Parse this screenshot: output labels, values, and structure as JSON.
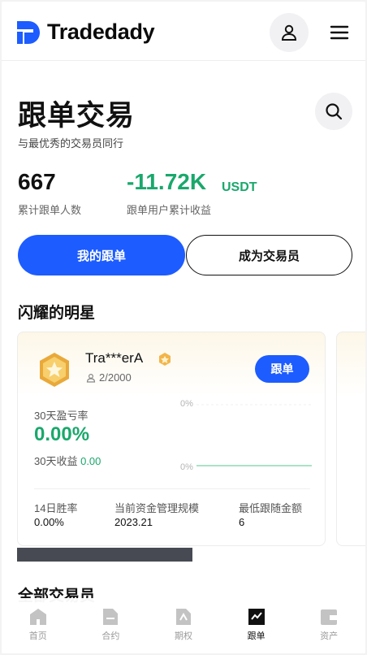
{
  "colors": {
    "accent": "#1d5cff",
    "positive": "#1aa86c",
    "text": "#111111"
  },
  "header": {
    "brand": "Tradedady"
  },
  "page": {
    "title": "跟单交易",
    "subtitle": "与最优秀的交易员同行"
  },
  "stats": {
    "followers_total": "667",
    "followers_label": "累计跟单人数",
    "profit_total": "-11.72K",
    "profit_unit": "USDT",
    "profit_label": "跟单用户累计收益"
  },
  "tabs": {
    "my_copy": "我的跟单",
    "become_trader": "成为交易员"
  },
  "sections": {
    "stars_title": "闪耀的明星",
    "all_traders_title": "全部交易员"
  },
  "trader_card": {
    "name": "Tra***erA",
    "followers": "2/2000",
    "follow_button": "跟单",
    "pnl_label": "30天盈亏率",
    "pnl_value": "0.00%",
    "income_label": "30天收益",
    "income_value": "0.00",
    "chart_top_label": "0%",
    "chart_bottom_label": "0%",
    "metrics": [
      {
        "label": "14日胜率",
        "value": "0.00%"
      },
      {
        "label": "当前资金管理规模",
        "value": "2023.21"
      },
      {
        "label": "最低跟随金额",
        "value": "6"
      }
    ]
  },
  "icons": {
    "header": [
      "logo-icon",
      "user-icon",
      "menu-icon"
    ],
    "search": "search-icon"
  },
  "bottom_nav": [
    {
      "label": "首页",
      "icon": "home-icon",
      "active": false
    },
    {
      "label": "合约",
      "icon": "contract-icon",
      "active": false
    },
    {
      "label": "期权",
      "icon": "options-icon",
      "active": false
    },
    {
      "label": "跟单",
      "icon": "copy-trade-icon",
      "active": true
    },
    {
      "label": "资产",
      "icon": "wallet-icon",
      "active": false
    }
  ]
}
